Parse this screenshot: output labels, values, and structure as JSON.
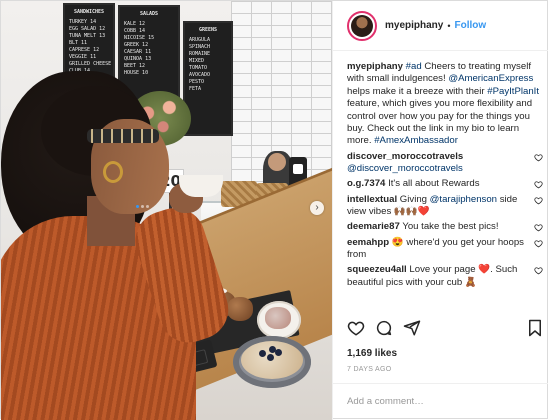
{
  "photo": {
    "menu_board_1": {
      "heading": "SANDWICHES",
      "rows": [
        "TURKEY 14",
        "EGG SALAD 12",
        "TUNA MELT 13",
        "BLT 11",
        "CAPRESE 12",
        "VEGGIE 11",
        "GRILLED CHEESE 10",
        "CLUB 14"
      ]
    },
    "menu_board_2": {
      "heading": "SALADS",
      "rows": [
        "KALE 12",
        "COBB 14",
        "NICOISE 15",
        "GREEK 12",
        "CAESAR 11",
        "QUINOA 13",
        "BEET 12",
        "HOUSE 10"
      ]
    },
    "menu_board_3": {
      "heading": "GREENS",
      "rows": [
        "ARUGULA",
        "SPINACH",
        "ROMAINE",
        "MIXED",
        "TOMATO",
        "AVOCADO",
        "PESTO",
        "FETA"
      ]
    },
    "table_number": "20",
    "carousel_next_icon": "chevron-right-icon"
  },
  "header": {
    "username": "myepiphany",
    "separator": "•",
    "follow_label": "Follow"
  },
  "caption": {
    "username": "myepiphany",
    "hashtag_ad": "#ad",
    "text_1": "Cheers to treating myself with small indulgences!",
    "mention": "@AmericanExpress",
    "text_2": "helps make it a breeze with their",
    "hashtag_feature": "#PayItPlanIt",
    "text_3": "feature, which gives you more flexibility and control over how you pay for the things you buy. Check out the link in my bio to learn more.",
    "hashtag_ambassador": "#AmexAmbassador"
  },
  "comments": [
    {
      "username": "discover_moroccotravels",
      "mention": "@discover_moroccotravels",
      "text": ""
    },
    {
      "username": "o.g.7374",
      "mention": "",
      "text": "It's all about Rewards"
    },
    {
      "username": "intellextual",
      "pre": "Giving",
      "mention": "@tarajiphenson",
      "text": "side view vibes 🙌🏾🙌🏾❤️"
    },
    {
      "username": "deemarie87",
      "mention": "",
      "text": "You take the best pics!"
    },
    {
      "username": "eemahpp",
      "mention": "",
      "text": "😍 where'd you get your hoops from"
    },
    {
      "username": "squeezeu4all",
      "mention": "",
      "text": "Love your page ❤️. Such beautiful pics with your cub 🧸"
    }
  ],
  "actions": {
    "like_icon": "heart-icon",
    "comment_icon": "comment-icon",
    "share_icon": "share-icon",
    "save_icon": "bookmark-icon"
  },
  "likes": "1,169 likes",
  "time_ago": "7 DAYS AGO",
  "add_comment_placeholder": "Add a comment…",
  "colors": {
    "link": "#003569",
    "follow": "#3897f0",
    "border": "#efefef"
  }
}
